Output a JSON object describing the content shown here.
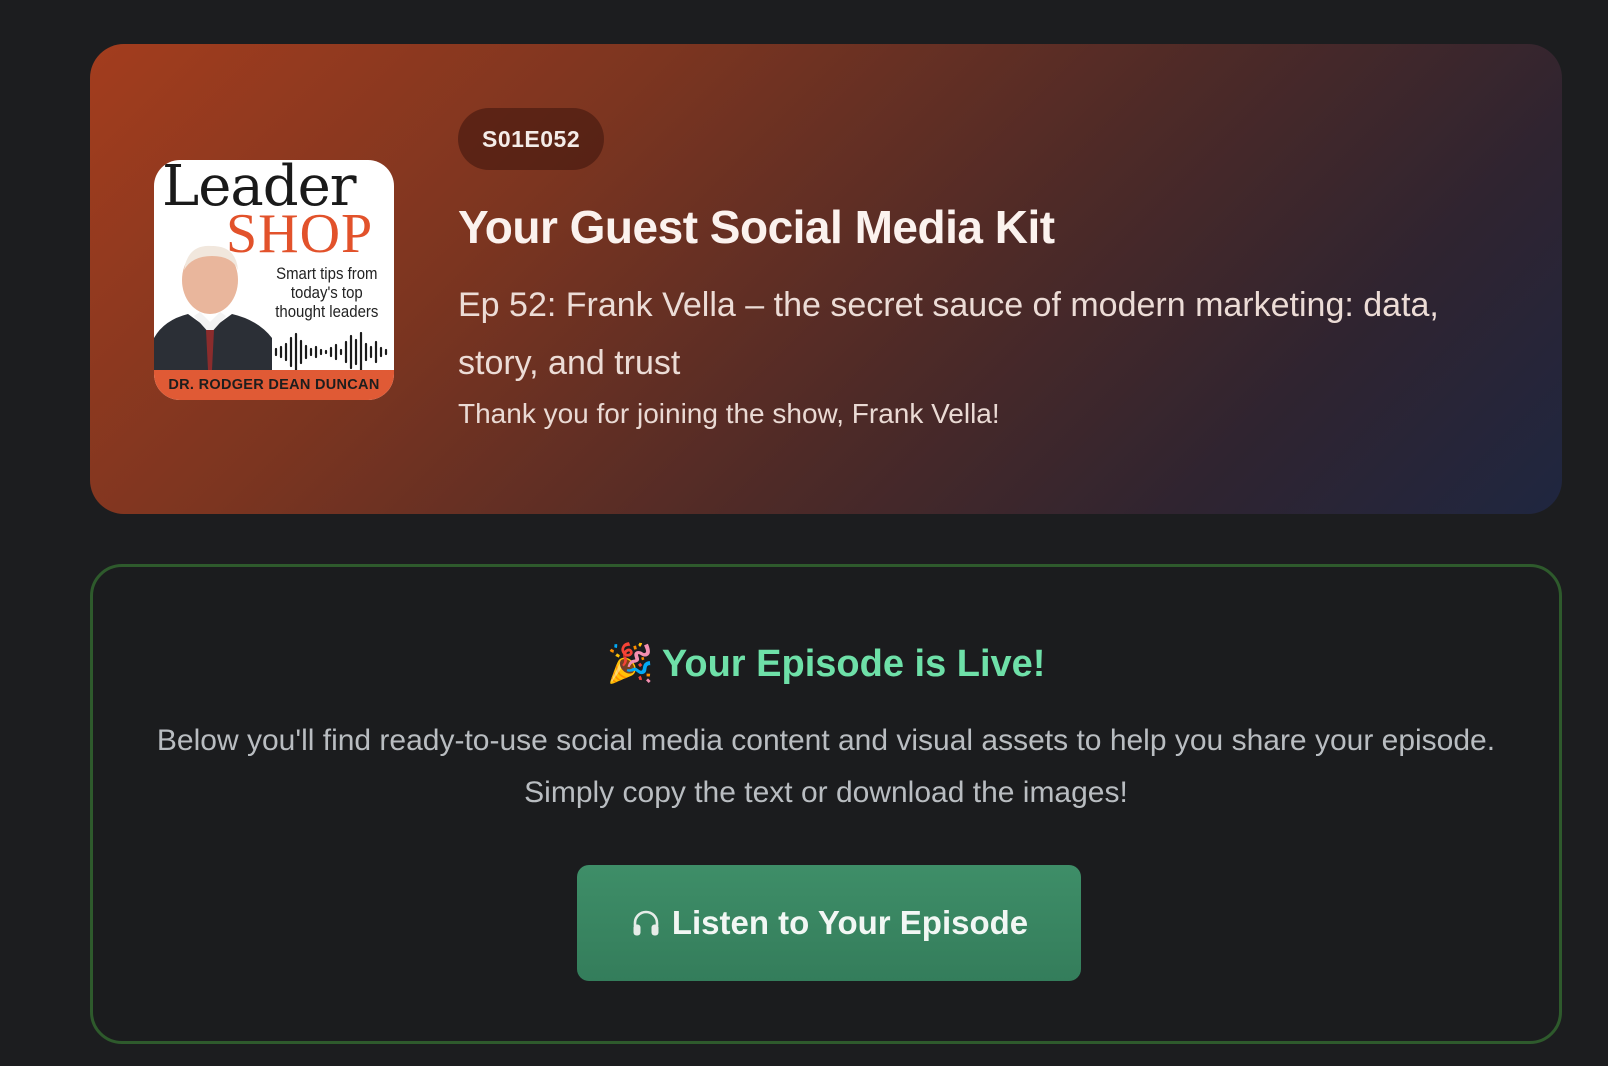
{
  "hero": {
    "cover": {
      "title_word1": "Leader",
      "title_word2": "SHOP",
      "tagline": "Smart tips from today's top thought leaders",
      "author": "DR. RODGER DEAN DUNCAN"
    },
    "badge": "S01E052",
    "title": "Your Guest Social Media Kit",
    "episode": "Ep 52: Frank Vella – the secret sauce of modern marketing: data, story, and trust",
    "thanks": "Thank you for joining the show, Frank Vella!"
  },
  "live": {
    "emoji": "🎉",
    "title": "Your Episode is Live!",
    "description": "Below you'll find ready-to-use social media content and visual assets to help you share your episode. Simply copy the text or download the images!",
    "button_icon": "headphones-icon",
    "button_label": "Listen to Your Episode"
  },
  "colors": {
    "hero_gradient_start": "#a33d1e",
    "hero_gradient_end": "#1f2640",
    "live_title": "#6ee0a8",
    "button_bg": "#3a8a63",
    "card_border": "#2e5a2c",
    "page_bg": "#1c1d1f"
  }
}
